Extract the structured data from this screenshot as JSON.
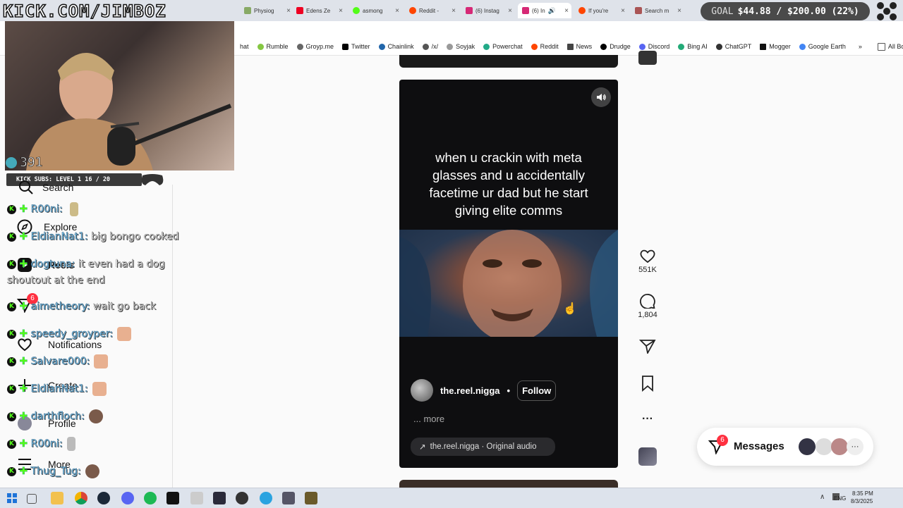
{
  "logo": {
    "text": "KICK.COM/JIMBOZ"
  },
  "goal": {
    "label": "GOAL",
    "value": "$44.88 / $200.00 (22%)"
  },
  "tabs": [
    {
      "label": "Physiog",
      "color": "#8a6"
    },
    {
      "label": "Edens Ze",
      "color": "#e02"
    },
    {
      "label": "asmong",
      "color": "#53fc18"
    },
    {
      "label": "Reddit -",
      "color": "#ff4500"
    },
    {
      "label": "(6) Instag",
      "color": "#d62976"
    },
    {
      "label": "(6) In",
      "color": "#d62976"
    },
    {
      "label": "If you're",
      "color": "#ff4500"
    },
    {
      "label": "Search m",
      "color": "#a55"
    }
  ],
  "bookmarks": [
    {
      "label": "hat",
      "color": "#888"
    },
    {
      "label": "Rumble",
      "color": "#85c742"
    },
    {
      "label": "Groyp.me",
      "color": "#666"
    },
    {
      "label": "Twitter",
      "color": "#000"
    },
    {
      "label": "Chainlink",
      "color": "#26a"
    },
    {
      "label": "/x/",
      "color": "#555"
    },
    {
      "label": "Soyjak",
      "color": "#999"
    },
    {
      "label": "Powerchat",
      "color": "#2a8"
    },
    {
      "label": "Reddit",
      "color": "#ff4500"
    },
    {
      "label": "News",
      "color": "#444"
    },
    {
      "label": "Drudge",
      "color": "#000"
    },
    {
      "label": "Discord",
      "color": "#5865f2"
    },
    {
      "label": "Bing AI",
      "color": "#2a7"
    },
    {
      "label": "ChatGPT",
      "color": "#333"
    },
    {
      "label": "Mogger",
      "color": "#111"
    },
    {
      "label": "Google Earth",
      "color": "#4285f4"
    }
  ],
  "all_bookmarks": "All Bookmarks",
  "stream": {
    "viewers": "391",
    "kick_subs": "KICK SUBS: LEVEL 1 16 / 20"
  },
  "nav": {
    "search": "Search",
    "explore": "Explore",
    "reels": "Reels",
    "notifications": "Notifications",
    "create": "Create",
    "profile": "Profile",
    "more": "More",
    "badge": "6"
  },
  "chat": [
    {
      "user": "R00ni:",
      "msg": "",
      "emote": true
    },
    {
      "user": "EldianNat1:",
      "msg": "big bongo cooked",
      "emote": false
    },
    {
      "user": "dogtuna:",
      "msg": "it even had a dog",
      "emote": false
    },
    {
      "user": "",
      "msg": "shoutout at the end",
      "emote": false
    },
    {
      "user": "aimetheory:",
      "msg": "wait go back",
      "emote": false
    },
    {
      "user": "speedy_groyper:",
      "msg": "",
      "emote": true
    },
    {
      "user": "Salvare000:",
      "msg": "",
      "emote": true
    },
    {
      "user": "EldianNat1:",
      "msg": "",
      "emote": true
    },
    {
      "user": "darthfloch:",
      "msg": "",
      "emote": true
    },
    {
      "user": "R00ni:",
      "msg": "",
      "emote": true
    },
    {
      "user": "Thug_Tug:",
      "msg": "",
      "emote": true
    }
  ],
  "reel": {
    "caption": "when u crackin with meta glasses and u accidentally facetime ur dad but he start giving elite comms",
    "author": "the.reel.nigga",
    "dot": "•",
    "follow": "Follow",
    "more": "... more",
    "audio": "the.reel.nigga · Original audio"
  },
  "actions": {
    "likes": "551K",
    "comments": "1,804"
  },
  "messages": {
    "label": "Messages",
    "badge": "6",
    "more": "···"
  },
  "taskbar": {
    "lang": "ENG",
    "time": "8:35 PM",
    "date": "8/3/2025"
  }
}
